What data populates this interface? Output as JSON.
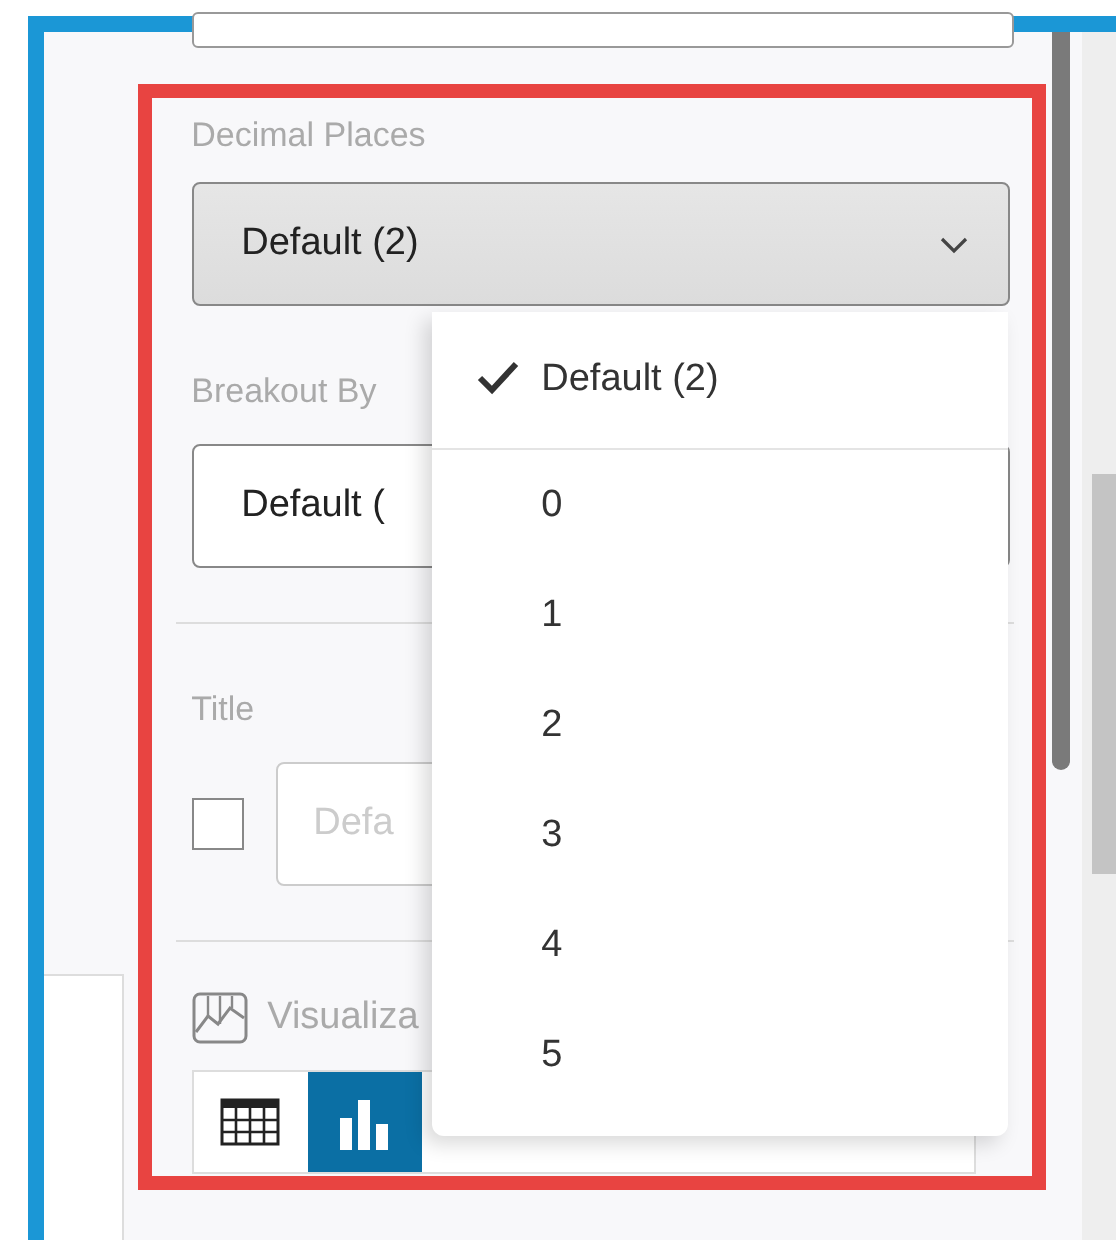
{
  "decimal_places": {
    "label": "Decimal Places",
    "value": "Default (2)",
    "expanded": true,
    "options": [
      {
        "label": "Default (2)",
        "selected": true
      },
      {
        "label": "0",
        "selected": false
      },
      {
        "label": "1",
        "selected": false
      },
      {
        "label": "2",
        "selected": false
      },
      {
        "label": "3",
        "selected": false
      },
      {
        "label": "4",
        "selected": false
      },
      {
        "label": "5",
        "selected": false
      }
    ]
  },
  "breakout_by": {
    "label": "Breakout By",
    "value": "Default ("
  },
  "title": {
    "label": "Title",
    "checked": false,
    "placeholder": "Defa"
  },
  "visualization": {
    "label": "Visualiza",
    "types": [
      {
        "kind": "table",
        "selected": false
      },
      {
        "kind": "bar",
        "selected": true
      }
    ]
  }
}
